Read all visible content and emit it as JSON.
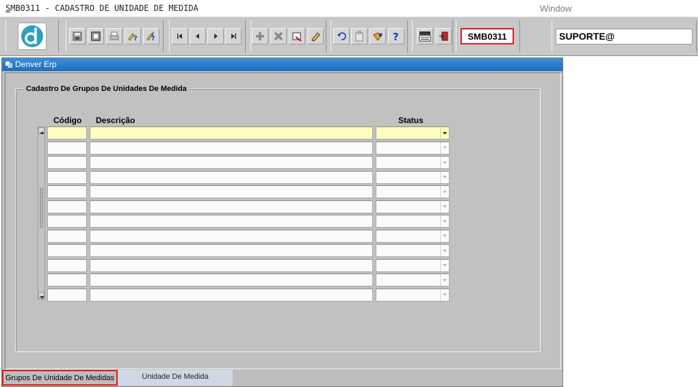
{
  "titlebar": {
    "app_title_first": "S",
    "app_title_rest": "MB0311 - CADASTRO DE UNIDADE DE MEDIDA",
    "window_menu": "Window"
  },
  "toolbar": {
    "logo_icon": "denver-d-logo-icon",
    "form_code": "SMB0311",
    "user": "SUPORTE@",
    "buttons": [
      "save-icon",
      "print-preview-icon",
      "print-icon",
      "query-help-icon",
      "execute-query-icon",
      "first-record-icon",
      "previous-record-icon",
      "next-record-icon",
      "last-record-icon",
      "insert-record-icon",
      "delete-record-icon",
      "clear-record-icon",
      "edit-record-icon",
      "undo-icon",
      "clipboard-icon",
      "list-values-icon",
      "help-icon",
      "menu-icon",
      "exit-icon"
    ]
  },
  "window": {
    "title": "Denver Erp",
    "frame_title": "Cadastro De Grupos De Unidades De Medida",
    "columns": {
      "code": "Código",
      "description": "Descrição",
      "status": "Status"
    },
    "rows": [
      {
        "code": "",
        "description": "",
        "status": ""
      },
      {
        "code": "",
        "description": "",
        "status": ""
      },
      {
        "code": "",
        "description": "",
        "status": ""
      },
      {
        "code": "",
        "description": "",
        "status": ""
      },
      {
        "code": "",
        "description": "",
        "status": ""
      },
      {
        "code": "",
        "description": "",
        "status": ""
      },
      {
        "code": "",
        "description": "",
        "status": ""
      },
      {
        "code": "",
        "description": "",
        "status": ""
      },
      {
        "code": "",
        "description": "",
        "status": ""
      },
      {
        "code": "",
        "description": "",
        "status": ""
      },
      {
        "code": "",
        "description": "",
        "status": ""
      },
      {
        "code": "",
        "description": "",
        "status": ""
      }
    ],
    "tabs": [
      {
        "label": "Grupos De Unidade De Medidas",
        "active": true
      },
      {
        "label": "Unidade De Medida",
        "active": false
      }
    ]
  },
  "colors": {
    "title_blue": "#1d6fc0",
    "current_row": "#fefec0",
    "highlight_red": "#e01b1b"
  }
}
